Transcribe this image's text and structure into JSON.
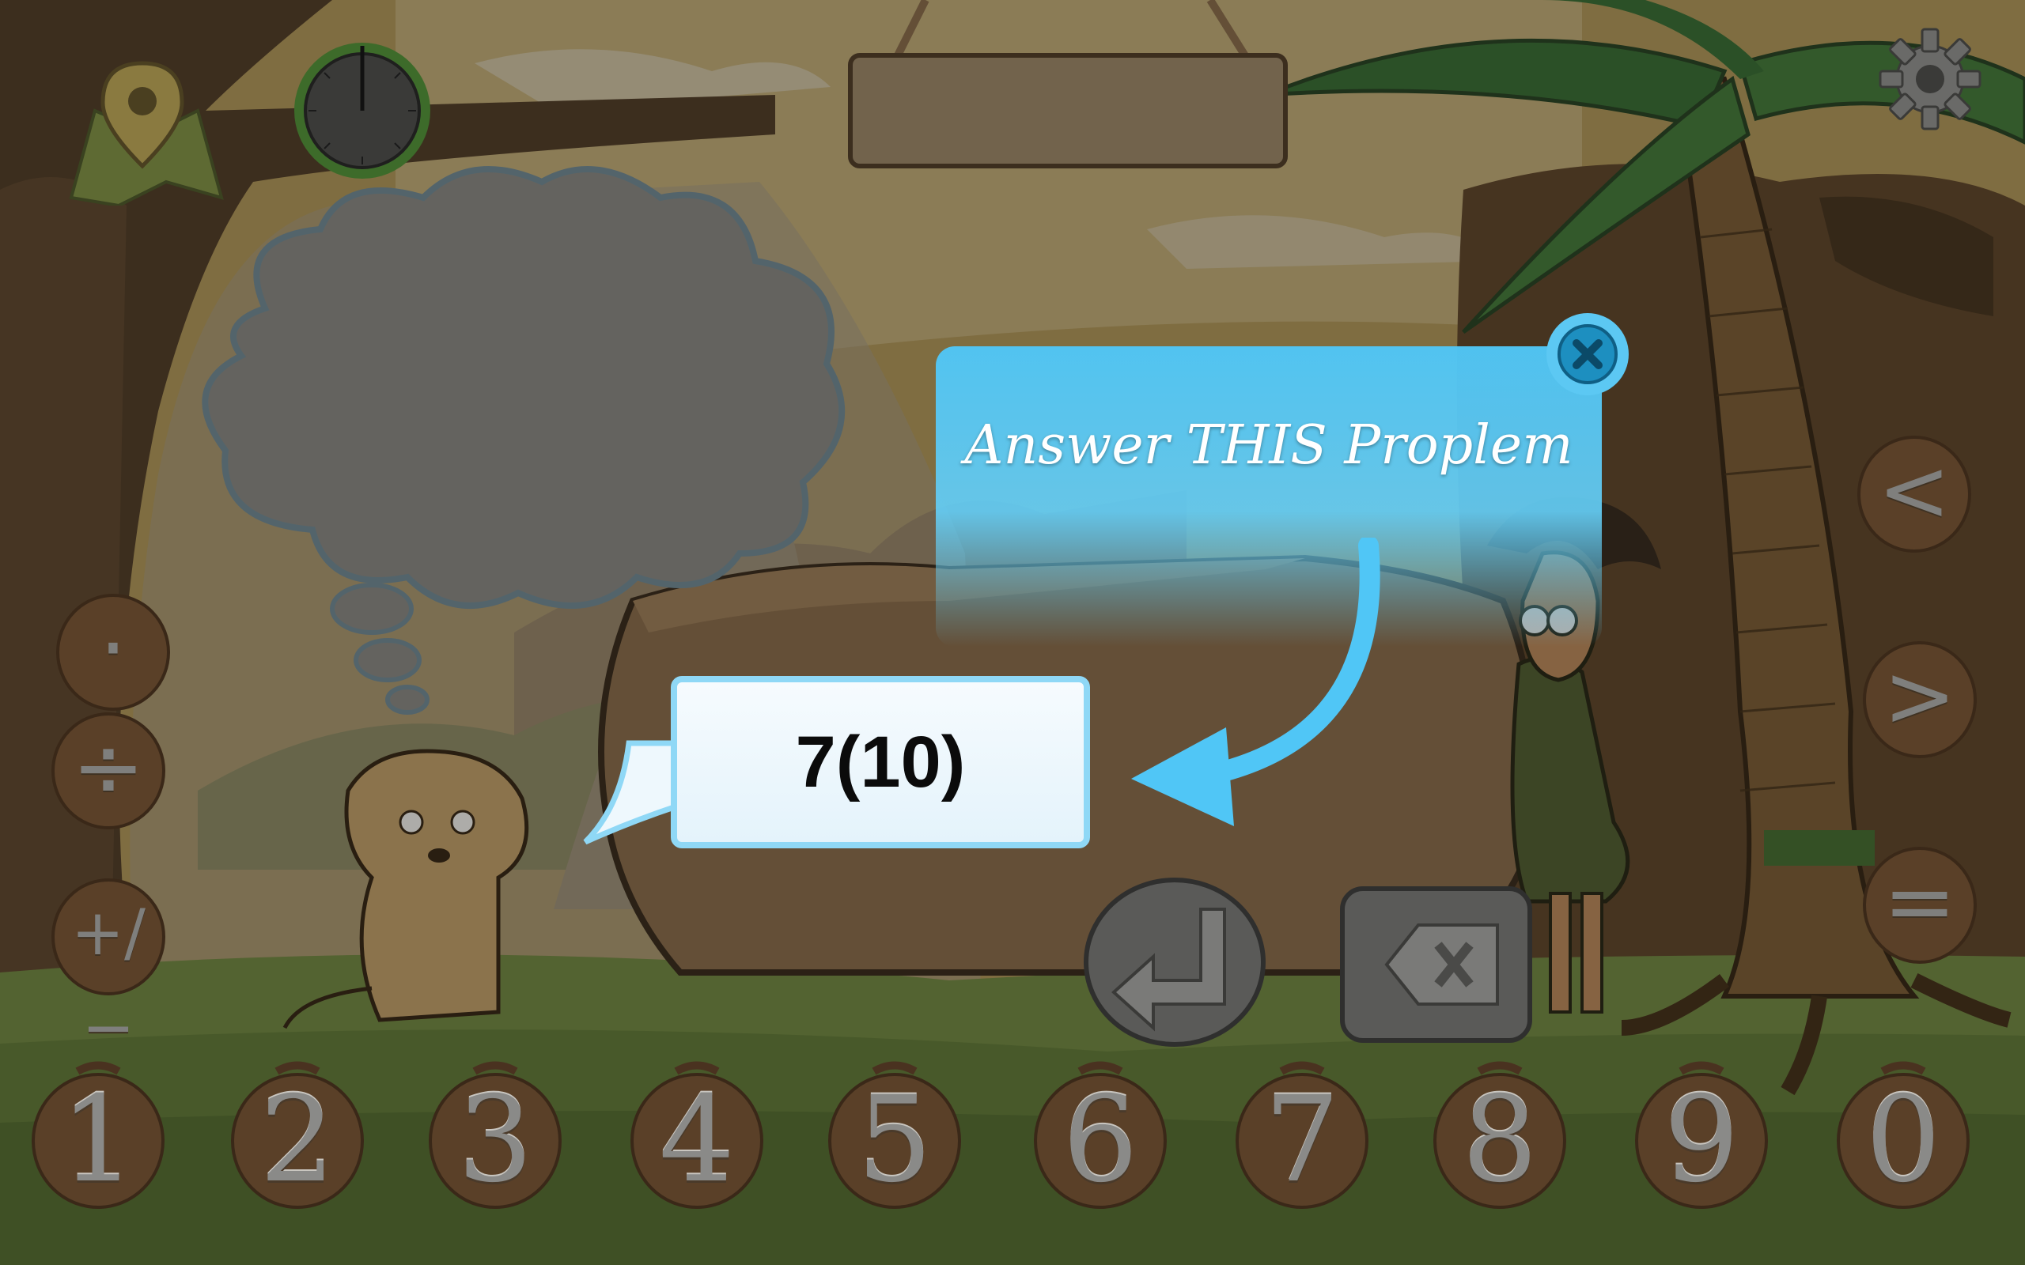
{
  "tooltip": {
    "title": "Answer THIS Proplem"
  },
  "problem": {
    "expression": "7(10)"
  },
  "number_pad": [
    {
      "label": "1"
    },
    {
      "label": "2"
    },
    {
      "label": "3"
    },
    {
      "label": "4"
    },
    {
      "label": "5"
    },
    {
      "label": "6"
    },
    {
      "label": "7"
    },
    {
      "label": "8"
    },
    {
      "label": "9"
    },
    {
      "label": "0"
    }
  ],
  "left_tools": [
    {
      "label": "·",
      "name": "decimal-point-button"
    },
    {
      "label": "÷",
      "name": "divide-button"
    },
    {
      "label": "+/−",
      "name": "plus-minus-button"
    }
  ],
  "right_tools": [
    {
      "label": "<",
      "name": "less-than-button"
    },
    {
      "label": ">",
      "name": "greater-than-button"
    },
    {
      "label": "=",
      "name": "equals-button"
    }
  ],
  "colors": {
    "tooltip_blue": "#50c6f6",
    "bubble_border": "#8fd8f6",
    "coconut_brown": "#6b4a33",
    "stone_gray": "#6a6a6a"
  },
  "icons": {
    "map": "map-pin-icon",
    "timer": "stopwatch-icon",
    "settings": "gear-icon",
    "enter": "enter-arrow-icon",
    "backspace": "backspace-icon",
    "close": "close-icon"
  }
}
